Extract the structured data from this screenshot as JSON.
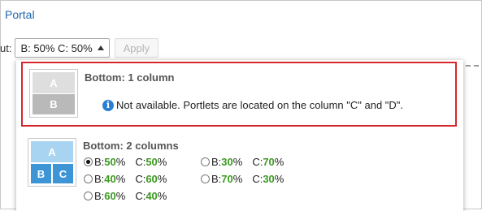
{
  "breadcrumb": {
    "label": "Portal"
  },
  "layout": {
    "label": "ut:",
    "select_value": "B: 50%  C: 50%",
    "apply_label": "Apply"
  },
  "option1": {
    "title": "Bottom: 1 column",
    "thumb": {
      "a": "A",
      "b": "B"
    },
    "message": "Not available. Portlets are located on the column \"C\" and \"D\".",
    "info_glyph": "i"
  },
  "option2": {
    "title": "Bottom: 2 columns",
    "thumb": {
      "a": "A",
      "b": "B",
      "c": "C"
    },
    "choices": [
      {
        "selected": true,
        "b": "50",
        "c": "50"
      },
      {
        "selected": false,
        "b": "30",
        "c": "70"
      },
      {
        "selected": false,
        "b": "40",
        "c": "60"
      },
      {
        "selected": false,
        "b": "70",
        "c": "30"
      },
      {
        "selected": false,
        "b": "60",
        "c": "40"
      }
    ],
    "prefix_b": "B:",
    "prefix_c": "C:",
    "pct_sign": "%"
  },
  "colors": {
    "accent_link": "#2366b0",
    "highlight_border": "#d6262d",
    "percent": "#3a9a1e"
  }
}
